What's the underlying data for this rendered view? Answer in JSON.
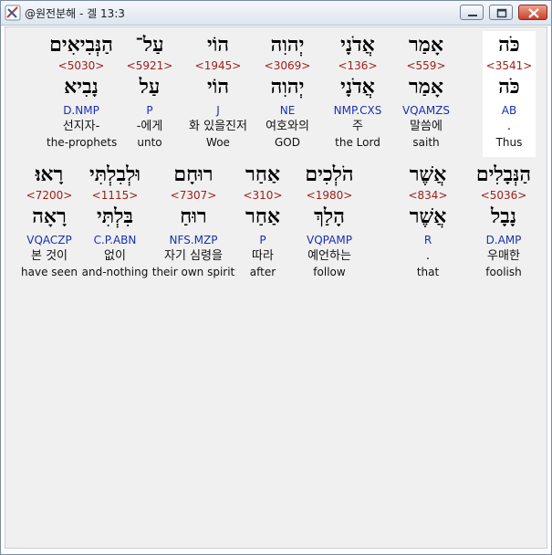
{
  "window": {
    "title": "@원전분해 - 겔 13:3",
    "minimize_label": "",
    "maximize_label": "",
    "close_label": ""
  },
  "rows": [
    {
      "words": [
        {
          "heb": "הַנְּבִיאִים",
          "strong": "<5030>",
          "lemma": "נָבִיא",
          "morph": "D.NMP",
          "korean": "선지자-",
          "english": "the-prophets",
          "selected": false
        },
        {
          "heb": "עַל־",
          "strong": "<5921>",
          "lemma": "עַל",
          "morph": "P",
          "korean": "-에게",
          "english": "unto",
          "selected": false
        },
        {
          "heb": "הוֹי",
          "strong": "<1945>",
          "lemma": "הוֹי",
          "morph": "J",
          "korean": "화 있을진저",
          "english": "Woe",
          "selected": false
        },
        {
          "heb": "יְהוִה",
          "strong": "<3069>",
          "lemma": "יְהוִה",
          "morph": "NE",
          "korean": "여호와의",
          "english": "GOD",
          "selected": false
        },
        {
          "heb": "אֲדֹנָי",
          "strong": "<136>",
          "lemma": "אֲדֹנָי",
          "morph": "NMP.CXS",
          "korean": "주",
          "english": "the Lord",
          "selected": false
        },
        {
          "heb": "אָמַר",
          "strong": "<559>",
          "lemma": "אָמַר",
          "morph": "VQAMZS",
          "korean": "말씀에",
          "english": "saith",
          "selected": false
        },
        {
          "heb": "כֹּה",
          "strong": "<3541>",
          "lemma": "כֹּה",
          "morph": "AB",
          "korean": ".",
          "english": "Thus",
          "selected": true
        }
      ]
    },
    {
      "words": [
        {
          "heb": "רָאוּ׃",
          "strong": "<7200>",
          "lemma": "רָאָה",
          "morph": "VQACZP",
          "korean": "본 것이",
          "english": "have seen",
          "selected": false
        },
        {
          "heb": "וּלְבִלְתִּי",
          "strong": "<1115>",
          "lemma": "בִּלְתִּי",
          "morph": "C.P.ABN",
          "korean": "없이",
          "english": "and-nothing",
          "selected": false
        },
        {
          "heb": "רוּחָם",
          "strong": "<7307>",
          "lemma": "רוּחַ",
          "morph": "NFS.MZP",
          "korean": "자기 심령을",
          "english": "their own spirit",
          "selected": false
        },
        {
          "heb": "אַחַר",
          "strong": "<310>",
          "lemma": "אַחַר",
          "morph": "P",
          "korean": "따라",
          "english": "after",
          "selected": false
        },
        {
          "heb": "הֹלְכִים",
          "strong": "<1980>",
          "lemma": "הָלַךְ",
          "morph": "VQPAMP",
          "korean": "예언하는",
          "english": "follow",
          "selected": false
        },
        {
          "heb": "אֲשֶׁר",
          "strong": "<834>",
          "lemma": "אֲשֶׁר",
          "morph": "R",
          "korean": ".",
          "english": "that",
          "selected": false
        },
        {
          "heb": "הַנְּבָלִים",
          "strong": "<5036>",
          "lemma": "נָבָל",
          "morph": "D.AMP",
          "korean": "우매한",
          "english": "foolish",
          "selected": false
        }
      ]
    }
  ]
}
